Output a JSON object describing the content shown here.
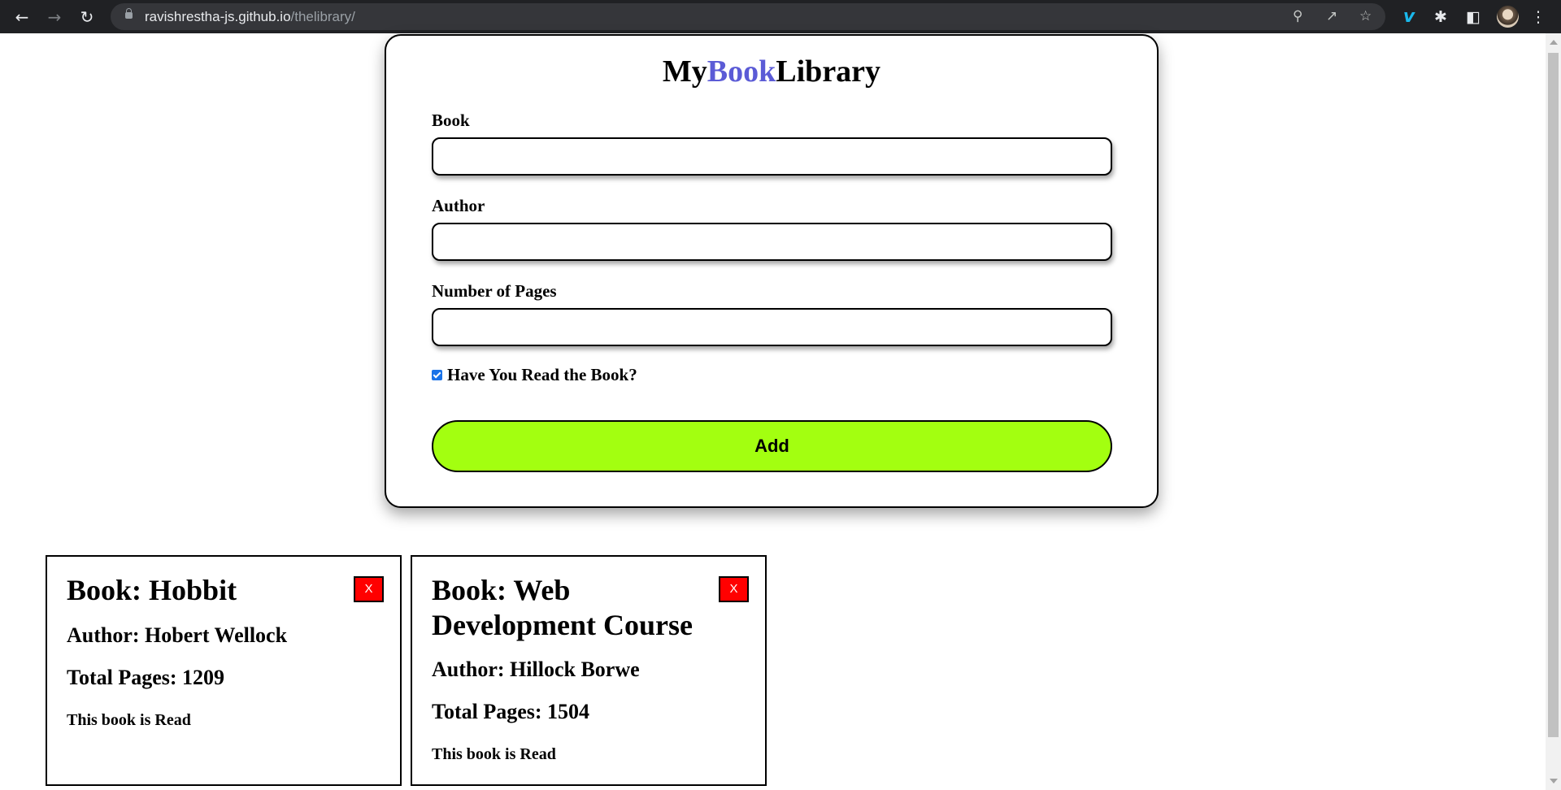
{
  "browser": {
    "url_host": "ravishrestha-js.github.io",
    "url_path": "/thelibrary/",
    "icons": [
      "back-icon",
      "forward-icon",
      "reload-icon",
      "lock-icon",
      "zoom-icon",
      "share-icon",
      "star-icon",
      "vimeo-icon",
      "extensions-icon",
      "sidepanel-icon",
      "avatar",
      "menu-icon"
    ]
  },
  "form": {
    "title_prefix": "My",
    "title_accent": "Book",
    "title_suffix": "Library",
    "accent_color": "#5b5bd6",
    "book_label": "Book",
    "book_value": "",
    "author_label": "Author",
    "author_value": "",
    "pages_label": "Number of Pages",
    "pages_value": "",
    "read_label": "Have You Read the Book?",
    "read_checked": true,
    "add_label": "Add",
    "add_color": "#a3ff10"
  },
  "books": [
    {
      "title": "Book: Hobbit",
      "author": "Author: Hobert Wellock",
      "pages": "Total Pages: 1209",
      "status": "This book is Read",
      "delete_label": "X"
    },
    {
      "title": "Book: Web Development Course",
      "author": "Author: Hillock Borwe",
      "pages": "Total Pages: 1504",
      "status": "This book is Read",
      "delete_label": "X"
    }
  ]
}
